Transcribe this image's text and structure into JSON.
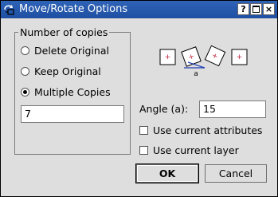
{
  "window": {
    "title": "Move/Rotate Options",
    "controls": {
      "help": "?",
      "maximize": "□",
      "close": "×"
    }
  },
  "copies_group": {
    "title": "Number of copies",
    "options": [
      {
        "label": "Delete Original",
        "selected": false
      },
      {
        "label": "Keep Original",
        "selected": false
      },
      {
        "label": "Multiple Copies",
        "selected": true
      }
    ],
    "count_value": "7"
  },
  "angle": {
    "label": "Angle (a):",
    "value": "15"
  },
  "illustration": {
    "angle_symbol": "a"
  },
  "options": {
    "use_current_attributes": {
      "label": "Use current attributes",
      "checked": false
    },
    "use_current_layer": {
      "label": "Use current layer",
      "checked": false
    }
  },
  "buttons": {
    "ok": "OK",
    "cancel": "Cancel"
  },
  "colors": {
    "titlebar": "#1e4fa2",
    "accent_red": "#c0203a",
    "angle_blue": "#1f3fb3"
  }
}
